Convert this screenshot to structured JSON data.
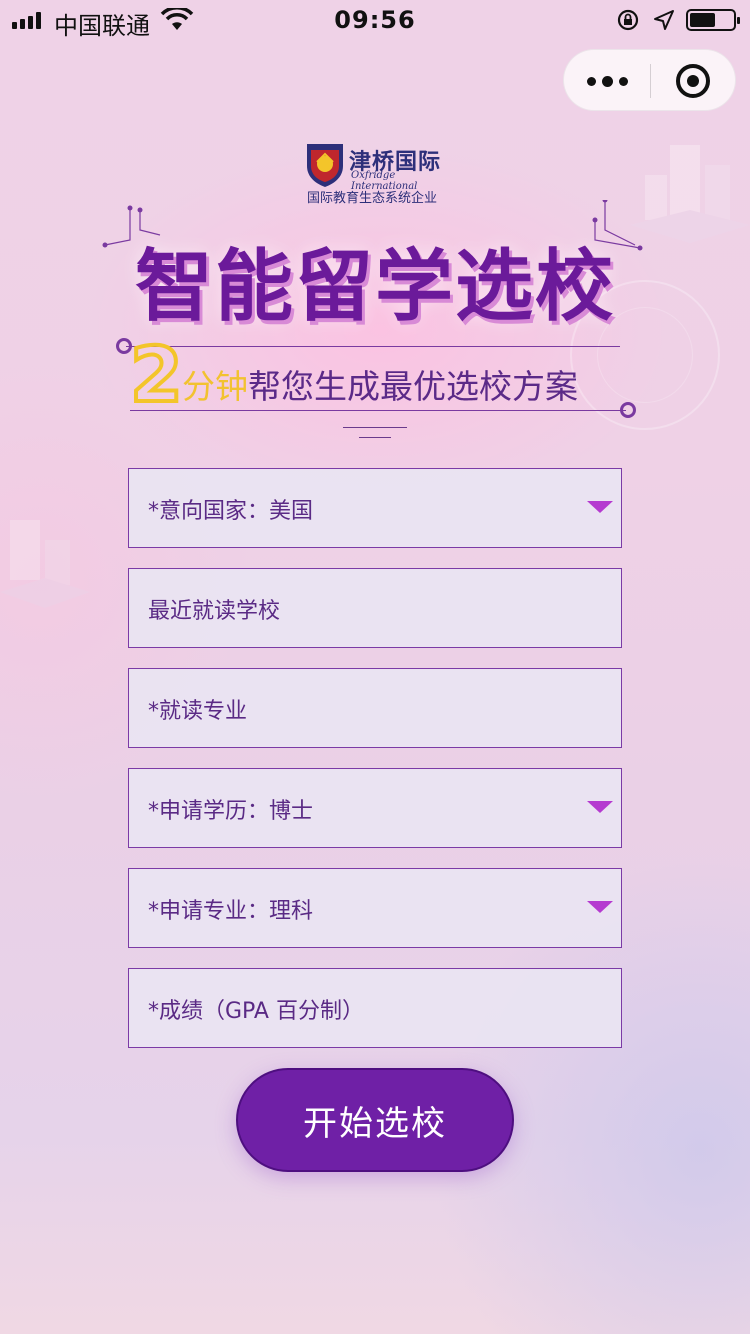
{
  "status_bar": {
    "carrier": "中国联通",
    "time": "09:56",
    "battery_level": 0.6
  },
  "capsule": {
    "more_icon": "more-dots-icon",
    "close_icon": "target-close-icon"
  },
  "brand": {
    "name_cn": "津桥国际",
    "name_en": "Oxfridge International",
    "slogan": "国际教育生态系统企业"
  },
  "hero": {
    "title": "智能留学选校",
    "big_number": "2",
    "subtitle_accent": "分钟",
    "subtitle_rest": "帮您生成最优选校方案"
  },
  "form": {
    "fields": [
      {
        "label": "*意向国家：美国",
        "type": "select"
      },
      {
        "label": "最近就读学校",
        "type": "input"
      },
      {
        "label": "*就读专业",
        "type": "input"
      },
      {
        "label": "*申请学历：博士",
        "type": "select"
      },
      {
        "label": "*申请专业：理科",
        "type": "select"
      },
      {
        "label": "*成绩（GPA 百分制）",
        "type": "input"
      }
    ],
    "submit_label": "开始选校"
  },
  "colors": {
    "primary": "#6f20a6",
    "accent": "#f2c230",
    "caret": "#b53ad0",
    "title": "#6b1a9a"
  }
}
